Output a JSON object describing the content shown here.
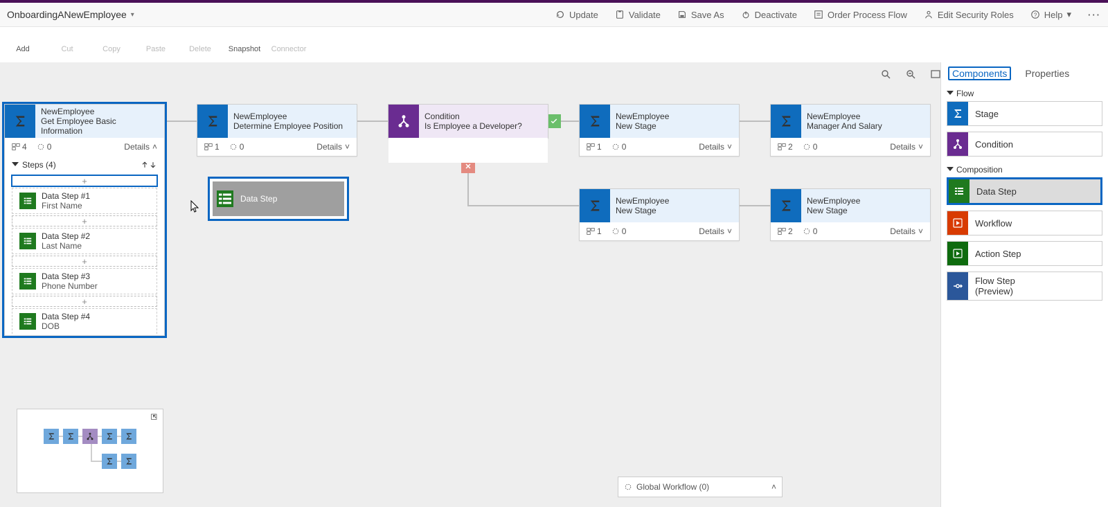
{
  "title": "OnboardingANewEmployee",
  "header_actions": {
    "update": "Update",
    "validate": "Validate",
    "save_as": "Save As",
    "deactivate": "Deactivate",
    "order": "Order Process Flow",
    "edit_roles": "Edit Security Roles",
    "help": "Help"
  },
  "toolbar": {
    "add": "Add",
    "cut": "Cut",
    "copy": "Copy",
    "paste": "Paste",
    "delete": "Delete",
    "snapshot": "Snapshot",
    "connector": "Connector"
  },
  "side": {
    "tab_components": "Components",
    "tab_properties": "Properties",
    "group_flow": "Flow",
    "group_composition": "Composition",
    "stage": "Stage",
    "condition": "Condition",
    "data_step": "Data Step",
    "workflow": "Workflow",
    "action_step": "Action Step",
    "flow_step": "Flow Step\n(Preview)"
  },
  "stages": {
    "s1": {
      "entity": "NewEmployee",
      "name": "Get Employee Basic Information",
      "steps": "4",
      "triggers": "0",
      "details": "Details",
      "steps_header": "Steps (4)"
    },
    "s2": {
      "entity": "NewEmployee",
      "name": "Determine Employee Position",
      "steps": "1",
      "triggers": "0",
      "details": "Details"
    },
    "cond": {
      "entity": "Condition",
      "name": "Is Employee a Developer?"
    },
    "s3": {
      "entity": "NewEmployee",
      "name": "New Stage",
      "steps": "1",
      "triggers": "0",
      "details": "Details"
    },
    "s4": {
      "entity": "NewEmployee",
      "name": "Manager And Salary",
      "steps": "2",
      "triggers": "0",
      "details": "Details"
    },
    "s5": {
      "entity": "NewEmployee",
      "name": "New Stage",
      "steps": "1",
      "triggers": "0",
      "details": "Details"
    },
    "s6": {
      "entity": "NewEmployee",
      "name": "New Stage",
      "steps": "2",
      "triggers": "0",
      "details": "Details"
    }
  },
  "steps": {
    "d1": {
      "t": "Data Step #1",
      "s": "First Name"
    },
    "d2": {
      "t": "Data Step #2",
      "s": "Last Name"
    },
    "d3": {
      "t": "Data Step #3",
      "s": "Phone Number"
    },
    "d4": {
      "t": "Data Step #4",
      "s": "DOB"
    }
  },
  "drag_step_label": "Data Step",
  "statusbar": {
    "label": "Global Workflow (0)"
  }
}
